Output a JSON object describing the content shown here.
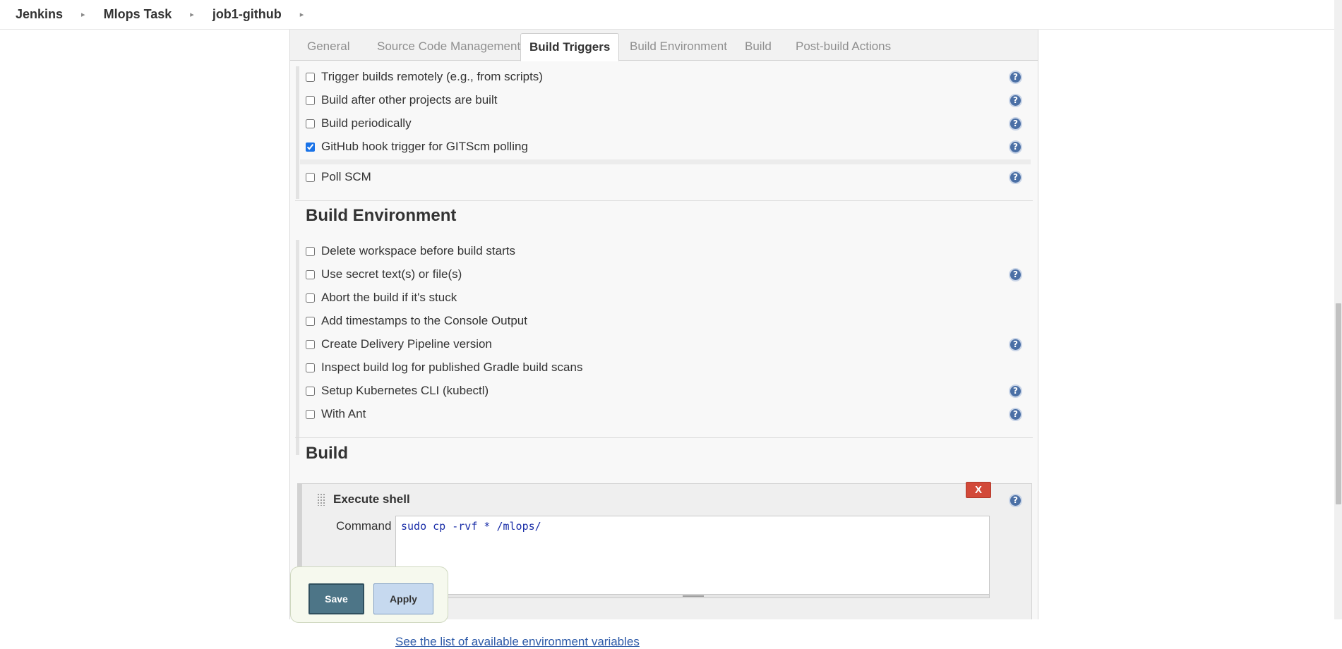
{
  "breadcrumb": [
    {
      "label": "Jenkins"
    },
    {
      "label": "Mlops Task"
    },
    {
      "label": "job1-github"
    }
  ],
  "tabs": [
    {
      "label": "General",
      "active": false
    },
    {
      "label": "Source Code Management",
      "active": false
    },
    {
      "label": "Build Triggers",
      "active": true
    },
    {
      "label": "Build Environment",
      "active": false
    },
    {
      "label": "Build",
      "active": false
    },
    {
      "label": "Post-build Actions",
      "active": false
    }
  ],
  "build_triggers": {
    "options": [
      {
        "label": "Trigger builds remotely (e.g., from scripts)",
        "checked": false,
        "help": true
      },
      {
        "label": "Build after other projects are built",
        "checked": false,
        "help": true
      },
      {
        "label": "Build periodically",
        "checked": false,
        "help": true
      },
      {
        "label": "GitHub hook trigger for GITScm polling",
        "checked": true,
        "help": true
      },
      {
        "label": "Poll SCM",
        "checked": false,
        "help": true
      }
    ]
  },
  "build_environment": {
    "title": "Build Environment",
    "options": [
      {
        "label": "Delete workspace before build starts",
        "checked": false,
        "help": false
      },
      {
        "label": "Use secret text(s) or file(s)",
        "checked": false,
        "help": true
      },
      {
        "label": "Abort the build if it's stuck",
        "checked": false,
        "help": false
      },
      {
        "label": "Add timestamps to the Console Output",
        "checked": false,
        "help": false
      },
      {
        "label": "Create Delivery Pipeline version",
        "checked": false,
        "help": true
      },
      {
        "label": "Inspect build log for published Gradle build scans",
        "checked": false,
        "help": false
      },
      {
        "label": "Setup Kubernetes CLI (kubectl)",
        "checked": false,
        "help": true
      },
      {
        "label": "With Ant",
        "checked": false,
        "help": true
      }
    ]
  },
  "build": {
    "title": "Build",
    "step": {
      "title": "Execute shell",
      "delete_label": "X",
      "command_label": "Command",
      "command_value": "sudo cp -rvf * /mlops/",
      "env_link": "See the list of available environment variables"
    }
  },
  "actions": {
    "save_label": "Save",
    "apply_label": "Apply"
  },
  "help_glyph": "?",
  "colors": {
    "save_button": "#4d7587",
    "apply_button": "#c6d9ef",
    "delete_button": "#d24939",
    "help_icon": "#4a6fa5",
    "link": "#2d5aa8",
    "command_text": "#1a2ea8"
  }
}
